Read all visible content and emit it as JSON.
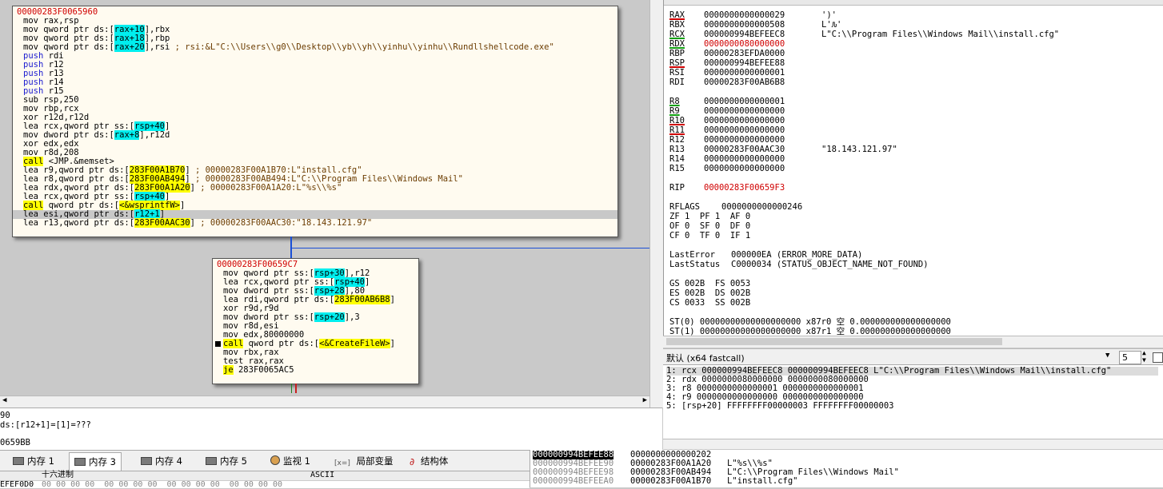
{
  "graph": {
    "block1": {
      "address": "00000283F0065960",
      "lines": [
        {
          "mn": "mov",
          "op": " rax,rsp"
        },
        {
          "mn": "mov",
          "op": " qword ptr ds:[rax+10],rbx"
        },
        {
          "mn": "mov",
          "op": " qword ptr ds:[rax+18],rbp"
        },
        {
          "mn": "mov",
          "op": " qword ptr ds:[rax+20],rsi",
          "cm": " ; rsi:&L\"C:\\\\Users\\\\g0\\\\Desktop\\\\yb\\\\yh\\\\yinhu\\\\yinhu\\\\Rundllshellcode.exe\""
        },
        {
          "mn": "push",
          "op": " rdi",
          "push": true
        },
        {
          "mn": "push",
          "op": " r12",
          "push": true
        },
        {
          "mn": "push",
          "op": " r13",
          "push": true
        },
        {
          "mn": "push",
          "op": " r14",
          "push": true
        },
        {
          "mn": "push",
          "op": " r15",
          "push": true
        },
        {
          "mn": "sub",
          "op": " rsp,250"
        },
        {
          "mn": "mov",
          "op": " rbp,rcx"
        },
        {
          "mn": "xor",
          "op": " r12d,r12d"
        },
        {
          "mn": "lea",
          "op": " rcx,qword ptr ss:[rsp+40]"
        },
        {
          "mn": "mov",
          "op": " dword ptr ds:[rax+8],r12d"
        },
        {
          "mn": "xor",
          "op": " edx,edx"
        },
        {
          "mn": "mov",
          "op": " r8d,208"
        },
        {
          "mn": "call",
          "op": " <JMP.&memset>"
        },
        {
          "mn": "lea",
          "op": " r9,qword ptr ds:[283F00A1B70]",
          "cm": " ; 00000283F00A1B70:L\"install.cfg\""
        },
        {
          "mn": "lea",
          "op": " r8,qword ptr ds:[283F00AB494]",
          "cm": " ; 00000283F00AB494:L\"C:\\\\Program Files\\\\Windows Mail\""
        },
        {
          "mn": "lea",
          "op": " rdx,qword ptr ds:[283F00A1A20]",
          "cm": " ; 00000283F00A1A20:L\"%s\\\\%s\""
        },
        {
          "mn": "lea",
          "op": " rcx,qword ptr ss:[rsp+40]"
        },
        {
          "mn": "call",
          "op": " qword ptr ds:[<&wsprintfW>]"
        },
        {
          "mn": "lea",
          "op": " esi,qword ptr ds:[r12+1]"
        },
        {
          "mn": "lea",
          "op": " r13,qword ptr ds:[283F00AAC30]",
          "cm": " ; 00000283F00AAC30:\"18.143.121.97\""
        }
      ]
    },
    "block2": {
      "address": "00000283F00659C7",
      "lines": [
        {
          "mn": "mov",
          "op": " qword ptr ss:[rsp+30],r12"
        },
        {
          "mn": "lea",
          "op": " rcx,qword ptr ss:[rsp+40]"
        },
        {
          "mn": "mov",
          "op": " dword ptr ss:[rsp+28],80"
        },
        {
          "mn": "lea",
          "op": " rdi,qword ptr ds:[283F00AB6B8]"
        },
        {
          "mn": "xor",
          "op": " r9d,r9d"
        },
        {
          "mn": "mov",
          "op": " dword ptr ss:[rsp+20],3"
        },
        {
          "mn": "mov",
          "op": " r8d,esi"
        },
        {
          "mn": "mov",
          "op": " edx,80000000"
        },
        {
          "mn": "call",
          "op": " qword ptr ds:[<&CreateFileW>]"
        },
        {
          "mn": "mov",
          "op": " rbx,rax"
        },
        {
          "mn": "test",
          "op": " rax,rax"
        },
        {
          "mn": "je",
          "op": " 283F0065AC5"
        }
      ]
    }
  },
  "registers": {
    "gp": [
      {
        "name": "RAX",
        "value": "0000000000000029",
        "comment": "')'"
      },
      {
        "name": "RBX",
        "value": "0000000000000508",
        "comment": "L'Ԉ'"
      },
      {
        "name": "RCX",
        "value": "000000994BEFEEC8",
        "comment": "L\"C:\\\\Program Files\\\\Windows Mail\\\\install.cfg\""
      },
      {
        "name": "RDX",
        "value": "0000000080000000",
        "comment": ""
      },
      {
        "name": "RBP",
        "value": "00000283EFDA0000",
        "comment": ""
      },
      {
        "name": "RSP",
        "value": "000000994BEFEE88",
        "comment": ""
      },
      {
        "name": "RSI",
        "value": "0000000000000001",
        "comment": ""
      },
      {
        "name": "RDI",
        "value": "00000283F00AB6B8",
        "comment": ""
      }
    ],
    "ext": [
      {
        "name": "R8",
        "value": "0000000000000001",
        "comment": ""
      },
      {
        "name": "R9",
        "value": "0000000000000000",
        "comment": ""
      },
      {
        "name": "R10",
        "value": "0000000000000000",
        "comment": ""
      },
      {
        "name": "R11",
        "value": "0000000000000000",
        "comment": ""
      },
      {
        "name": "R12",
        "value": "0000000000000000",
        "comment": ""
      },
      {
        "name": "R13",
        "value": "00000283F00AAC30",
        "comment": "\"18.143.121.97\""
      },
      {
        "name": "R14",
        "value": "0000000000000000",
        "comment": ""
      },
      {
        "name": "R15",
        "value": "0000000000000000",
        "comment": ""
      }
    ],
    "rip": {
      "name": "RIP",
      "value": "00000283F00659F3"
    },
    "rflags": {
      "name": "RFLAGS",
      "value": "0000000000000246"
    },
    "flags": [
      "ZF 1  PF 1  AF 0",
      "OF 0  SF 0  DF 0",
      "CF 0  TF 0  IF 1"
    ],
    "last_error": {
      "label": "LastError",
      "value": "000000EA (ERROR_MORE_DATA)"
    },
    "last_status": {
      "label": "LastStatus",
      "value": "C0000034 (STATUS_OBJECT_NAME_NOT_FOUND)"
    },
    "segments": [
      "GS 002B  FS 0053",
      "ES 002B  DS 002B",
      "CS 0033  SS 002B"
    ],
    "fpu": [
      "ST(0) 00000000000000000000 x87r0 空 0.000000000000000000",
      "ST(1) 00000000000000000000 x87r1 空 0.000000000000000000"
    ]
  },
  "callconv": {
    "label": "默认 (x64 fastcall)",
    "count": "5",
    "args": [
      "1: rcx 000000994BEFEEC8 000000994BEFEEC8 L\"C:\\\\Program Files\\\\Windows Mail\\\\install.cfg\"",
      "2: rdx 0000000080000000 0000000080000000",
      "3: r8 0000000000000001 0000000000000001",
      "4: r9 0000000000000000 0000000000000000",
      "5: [rsp+20] FFFFFFFF00000003 FFFFFFFF00000003"
    ]
  },
  "info": {
    "lines": [
      "90",
      "ds:[r12+1]=[1]=???",
      "",
      "0659BB"
    ]
  },
  "tabs": [
    {
      "label": "内存 1",
      "icon": "memory-icon"
    },
    {
      "label": "内存 3",
      "icon": "memory-icon",
      "active": true
    },
    {
      "label": "内存 4",
      "icon": "memory-icon"
    },
    {
      "label": "内存 5",
      "icon": "memory-icon"
    },
    {
      "label": "监视 1",
      "icon": "watch-icon"
    },
    {
      "label": "局部变量",
      "icon": "locals-icon",
      "prefix": "[x=]"
    },
    {
      "label": "结构体",
      "icon": "struct-icon"
    }
  ],
  "dump": {
    "hex_header": "十六进制",
    "ascii_header": "ASCII",
    "row_addr": "EFEF0D0",
    "row_hex": "00 00 00 00  00 00 00 00  00 00 00 00  00 00 00 00"
  },
  "stack": [
    {
      "addr": "000000994BEFEE88",
      "value": "0000000000000202",
      "comment": "",
      "selected": true
    },
    {
      "addr": "000000994BEFEE90",
      "value": "00000283F00A1A20",
      "comment": "L\"%s\\\\%s\""
    },
    {
      "addr": "000000994BEFEE98",
      "value": "00000283F00AB494",
      "comment": "L\"C:\\\\Program Files\\\\Windows Mail\""
    },
    {
      "addr": "000000994BEFEEA0",
      "value": "00000283F00A1B70",
      "comment": "L\"install.cfg\""
    }
  ]
}
